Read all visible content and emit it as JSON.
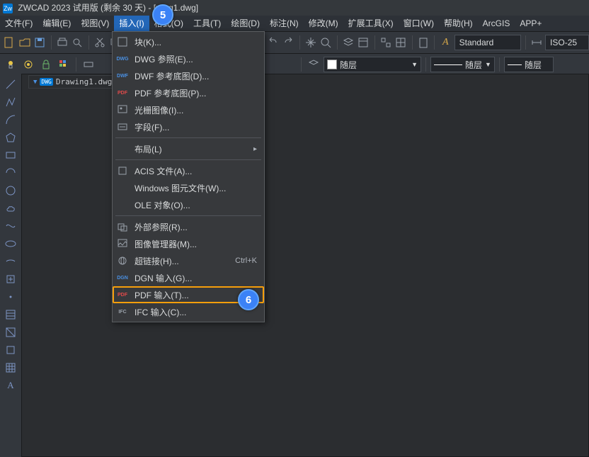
{
  "title": {
    "app_name": "ZWCAD 2023 试用版 (剩余 30 天)",
    "document": "wing1.dwg"
  },
  "menubar": [
    {
      "label": "文件(F)"
    },
    {
      "label": "编辑(E)"
    },
    {
      "label": "视图(V)"
    },
    {
      "label": "插入(I)",
      "active": true
    },
    {
      "label": "格式(O)"
    },
    {
      "label": "工具(T)"
    },
    {
      "label": "绘图(D)"
    },
    {
      "label": "标注(N)"
    },
    {
      "label": "修改(M)"
    },
    {
      "label": "扩展工具(X)"
    },
    {
      "label": "窗口(W)"
    },
    {
      "label": "帮助(H)"
    },
    {
      "label": "ArcGIS"
    },
    {
      "label": "APP+"
    }
  ],
  "menu_items": {
    "block": "块(K)...",
    "dwg_ref": "DWG 参照(E)...",
    "dwf_ref": "DWF 参考底图(D)...",
    "pdf_ref": "PDF 参考底图(P)...",
    "raster": "光栅图像(I)...",
    "field": "字段(F)...",
    "layout": "布局(L)",
    "acis": "ACIS 文件(A)...",
    "wmf": "Windows 图元文件(W)...",
    "ole": "OLE 对象(O)...",
    "xref": "外部参照(R)...",
    "imgmgr": "图像管理器(M)...",
    "hyperlink": "超链接(H)...",
    "hyperlink_shortcut": "Ctrl+K",
    "dgn": "DGN 输入(G)...",
    "pdf_import": "PDF 输入(T)...",
    "ifc": "IFC 输入(C)..."
  },
  "layer": {
    "current": "随层",
    "random_layer2": "随层",
    "random_layer3": "随层"
  },
  "style": {
    "annotative_icon": "A",
    "current": "Standard",
    "dim_style": "ISO-25"
  },
  "doc_tab": {
    "badge": "DWG",
    "name": "Drawing1.dwg"
  },
  "callouts": {
    "c5": "5",
    "c6": "6"
  }
}
